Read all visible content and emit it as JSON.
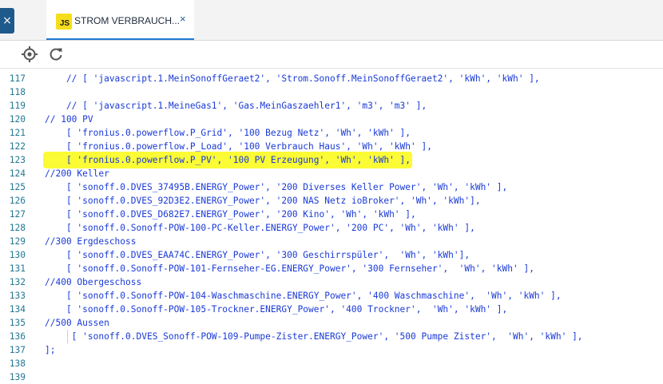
{
  "tab": {
    "title": "STROM VERBRAUCH...",
    "badge": "JS",
    "close": "×"
  },
  "sidebar_close": "×",
  "toolbar": {
    "icons": [
      "target-icon",
      "refresh-icon"
    ]
  },
  "colors": {
    "code": "#1a3ad6",
    "line_number": "#237893",
    "highlight": "#fbfb36",
    "tab_accent": "#1f7ad1",
    "js_badge": "#f5de19"
  },
  "editor": {
    "lines": [
      {
        "n": "117",
        "text": "    // [ 'javascript.1.MeinSonoffGeraet2', 'Strom.Sonoff.MeinSonoffGeraet2', 'kWh', 'kWh' ],"
      },
      {
        "n": "118",
        "text": ""
      },
      {
        "n": "119",
        "text": "    // [ 'javascript.1.MeineGas1', 'Gas.MeinGaszaehler1', 'm3', 'm3' ],"
      },
      {
        "n": "120",
        "text": "// 100 PV"
      },
      {
        "n": "121",
        "text": "    [ 'fronius.0.powerflow.P_Grid', '100 Bezug Netz', 'Wh', 'kWh' ],"
      },
      {
        "n": "122",
        "text": "    [ 'fronius.0.powerflow.P_Load', '100 Verbrauch Haus', 'Wh', 'kWh' ],"
      },
      {
        "n": "123",
        "text": "    [ 'fronius.0.powerflow.P_PV', '100 PV Erzeugung', 'Wh', 'kWh' ],",
        "highlight": true
      },
      {
        "n": "124",
        "text": "//200 Keller"
      },
      {
        "n": "125",
        "text": "    [ 'sonoff.0.DVES_37495B.ENERGY_Power', '200 Diverses Keller Power', 'Wh', 'kWh' ],"
      },
      {
        "n": "126",
        "text": "    [ 'sonoff.0.DVES_92D3E2.ENERGY_Power', '200 NAS Netz ioBroker', 'Wh', 'kWh'],"
      },
      {
        "n": "127",
        "text": "    [ 'sonoff.0.DVES_D682E7.ENERGY_Power', '200 Kino', 'Wh', 'kWh' ],"
      },
      {
        "n": "128",
        "text": "    [ 'sonoff.0.Sonoff-POW-100-PC-Keller.ENERGY_Power', '200 PC', 'Wh', 'kWh' ],"
      },
      {
        "n": "129",
        "text": "//300 Ergdeschoss"
      },
      {
        "n": "130",
        "text": "    [ 'sonoff.0.DVES_EAA74C.ENERGY_Power', '300 Geschirrspüler',  'Wh', 'kWh'],"
      },
      {
        "n": "131",
        "text": "    [ 'sonoff.0.Sonoff-POW-101-Fernseher-EG.ENERGY_Power', '300 Fernseher',  'Wh', 'kWh' ],"
      },
      {
        "n": "132",
        "text": "//400 Obergeschoss"
      },
      {
        "n": "133",
        "text": "    [ 'sonoff.0.Sonoff-POW-104-Waschmaschine.ENERGY_Power', '400 Waschmaschine',  'Wh', 'kWh' ],"
      },
      {
        "n": "134",
        "text": "    [ 'sonoff.0.Sonoff-POW-105-Trockner.ENERGY_Power', '400 Trockner',  'Wh', 'kWh' ],"
      },
      {
        "n": "135",
        "text": "//500 Aussen"
      },
      {
        "n": "136",
        "text": "     [ 'sonoff.0.DVES_Sonoff-POW-109-Pumpe-Zister.ENERGY_Power', '500 Pumpe Zister',  'Wh', 'kWh' ],"
      },
      {
        "n": "137",
        "text": "];"
      },
      {
        "n": "138",
        "text": ""
      },
      {
        "n": "139",
        "text": ""
      }
    ]
  }
}
